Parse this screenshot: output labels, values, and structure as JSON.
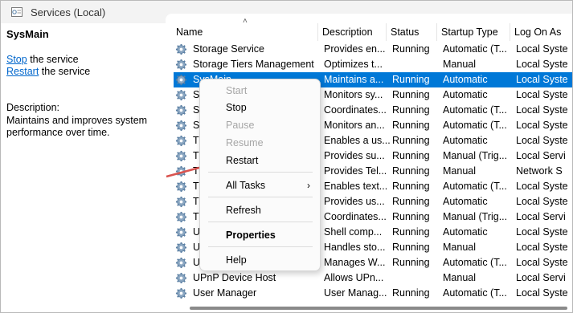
{
  "window": {
    "title": "Services (Local)"
  },
  "left_pane": {
    "service_name": "SysMain",
    "stop_link": "Stop",
    "stop_suffix": " the service",
    "restart_link": "Restart",
    "restart_suffix": " the service",
    "description_label": "Description:",
    "description_text": "Maintains and improves system performance over time."
  },
  "table": {
    "columns": [
      "Name",
      "Description",
      "Status",
      "Startup Type",
      "Log On As"
    ],
    "rows": [
      {
        "name": "Storage Service",
        "description": "Provides en...",
        "status": "Running",
        "startup": "Automatic (T...",
        "logon": "Local Syste"
      },
      {
        "name": "Storage Tiers Management",
        "description": "Optimizes t...",
        "status": "",
        "startup": "Manual",
        "logon": "Local Syste"
      },
      {
        "name": "SysMain",
        "description": "Maintains a...",
        "status": "Running",
        "startup": "Automatic",
        "logon": "Local Syste",
        "selected": true
      },
      {
        "name": "S",
        "description": "Monitors sy...",
        "status": "Running",
        "startup": "Automatic",
        "logon": "Local Syste"
      },
      {
        "name": "S",
        "description": "Coordinates...",
        "status": "Running",
        "startup": "Automatic (T...",
        "logon": "Local Syste"
      },
      {
        "name": "S",
        "description": "Monitors an...",
        "status": "Running",
        "startup": "Automatic (T...",
        "logon": "Local Syste"
      },
      {
        "name": "T",
        "description": "Enables a us...",
        "status": "Running",
        "startup": "Automatic",
        "logon": "Local Syste"
      },
      {
        "name": "T",
        "description": "Provides su...",
        "status": "Running",
        "startup": "Manual (Trig...",
        "logon": "Local Servi"
      },
      {
        "name": "T",
        "description": "Provides Tel...",
        "status": "Running",
        "startup": "Manual",
        "logon": "Network S"
      },
      {
        "name": "T",
        "description": "Enables text...",
        "status": "Running",
        "startup": "Automatic (T...",
        "logon": "Local Syste"
      },
      {
        "name": "T",
        "description": "Provides us...",
        "status": "Running",
        "startup": "Automatic",
        "logon": "Local Syste"
      },
      {
        "name": "T",
        "description": "Coordinates...",
        "status": "Running",
        "startup": "Manual (Trig...",
        "logon": "Local Servi"
      },
      {
        "name": "U",
        "description": "Shell comp...",
        "status": "Running",
        "startup": "Automatic",
        "logon": "Local Syste"
      },
      {
        "name": "U",
        "description": "Handles sto...",
        "status": "Running",
        "startup": "Manual",
        "logon": "Local Syste"
      },
      {
        "name": "U",
        "description": "Manages W...",
        "status": "Running",
        "startup": "Automatic (T...",
        "logon": "Local Syste"
      },
      {
        "name": "UPnP Device Host",
        "description": "Allows UPn...",
        "status": "",
        "startup": "Manual",
        "logon": "Local Servi"
      },
      {
        "name": "User Manager",
        "description": "User Manag...",
        "status": "Running",
        "startup": "Automatic (T...",
        "logon": "Local Syste"
      }
    ]
  },
  "context_menu": {
    "start": "Start",
    "stop": "Stop",
    "pause": "Pause",
    "resume": "Resume",
    "restart": "Restart",
    "all_tasks": "All Tasks",
    "refresh": "Refresh",
    "properties": "Properties",
    "help": "Help"
  },
  "colors": {
    "selection": "#0078d7",
    "link": "#0066cc",
    "arrow": "#d9534f"
  }
}
